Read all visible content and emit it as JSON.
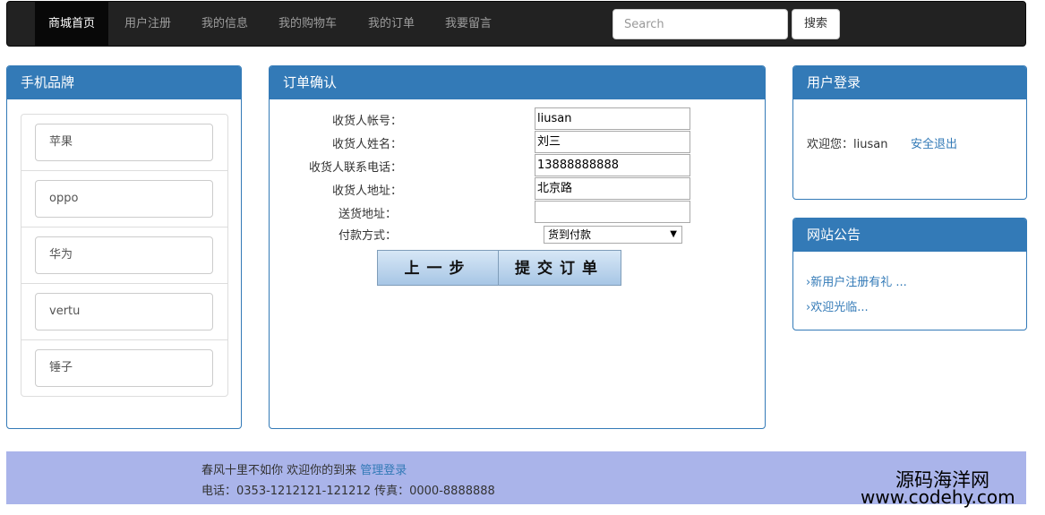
{
  "nav": {
    "items": [
      {
        "label": "商城首页"
      },
      {
        "label": "用户注册"
      },
      {
        "label": "我的信息"
      },
      {
        "label": "我的购物车"
      },
      {
        "label": "我的订单"
      },
      {
        "label": "我要留言"
      }
    ],
    "search_placeholder": "Search",
    "search_button": "搜索"
  },
  "brands": {
    "title": "手机品牌",
    "items": [
      {
        "label": "苹果"
      },
      {
        "label": "oppo"
      },
      {
        "label": "华为"
      },
      {
        "label": "vertu"
      },
      {
        "label": "锤子"
      }
    ]
  },
  "order": {
    "title": "订单确认",
    "fields": [
      {
        "label": "收货人帐号：",
        "value": "liusan"
      },
      {
        "label": "收货人姓名：",
        "value": "刘三"
      },
      {
        "label": "收货人联系电话：",
        "value": "13888888888"
      },
      {
        "label": "收货人地址：",
        "value": "北京路"
      },
      {
        "label": "送货地址：",
        "value": ""
      }
    ],
    "payment_label": "付款方式：",
    "payment_selected": "货到付款",
    "prev_button": "上一步",
    "submit_button": "提交订单"
  },
  "login": {
    "title": "用户登录",
    "welcome": "欢迎您：liusan",
    "logout": "安全退出"
  },
  "notice": {
    "title": "网站公告",
    "items": [
      {
        "label": "新用户注册有礼 ..."
      },
      {
        "label": "欢迎光临..."
      }
    ]
  },
  "footer": {
    "line1": "春风十里不如你 欢迎你的到来",
    "admin_link": "管理登录",
    "line2": "电话：0353-1212121-121212 传真：0000-8888888"
  },
  "watermark": {
    "line1": "源码海洋网",
    "line2": "www.codehy.com"
  },
  "colors": {
    "primary": "#337ab7",
    "navbar": "#222222",
    "footer": "#aab4ea"
  }
}
